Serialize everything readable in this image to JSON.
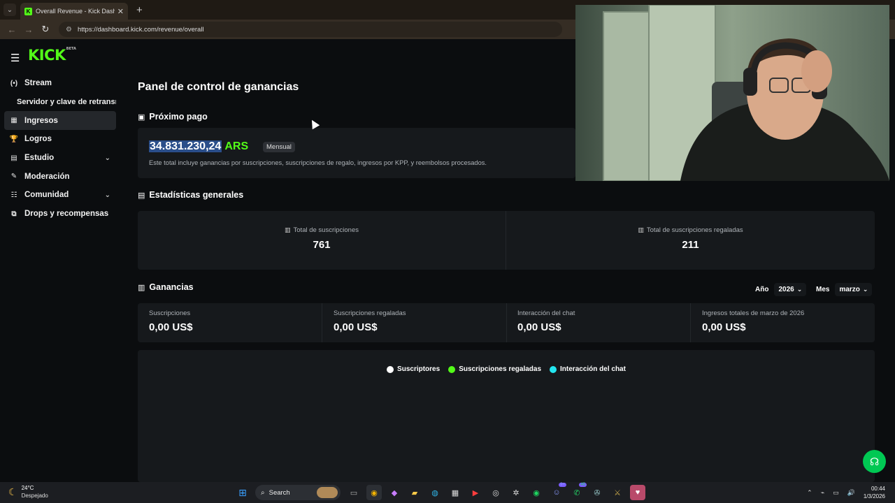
{
  "browser": {
    "tab_title": "Overall Revenue - Kick Dashbo...",
    "favicon": "K",
    "new_tab": "+",
    "url": "https://dashboard.kick.com/revenue/overall"
  },
  "brand": {
    "logo": "KICK",
    "logo_tag": "BETA",
    "accent": "#53fc18"
  },
  "sidebar": {
    "items": [
      {
        "label": "Stream",
        "icon": "broadcast-icon",
        "glyph": "(•)"
      },
      {
        "label": "Servidor y clave de retransmisión",
        "icon": "",
        "glyph": ""
      },
      {
        "label": "Ingresos",
        "icon": "revenue-icon",
        "glyph": "▦"
      },
      {
        "label": "Logros",
        "icon": "trophy-icon",
        "glyph": "🏆"
      },
      {
        "label": "Estudio",
        "icon": "studio-icon",
        "glyph": "▤"
      },
      {
        "label": "Moderación",
        "icon": "wrench-icon",
        "glyph": "✎"
      },
      {
        "label": "Comunidad",
        "icon": "community-icon",
        "glyph": "☷"
      },
      {
        "label": "Drops y recompensas",
        "icon": "drops-icon",
        "glyph": "⧉"
      }
    ]
  },
  "main": {
    "title": "Panel de control de ganancias",
    "next_payment": {
      "heading": "Próximo pago",
      "amount": "34.831.230,24",
      "currency": "ARS",
      "badge": "Mensual",
      "description": "Este total incluye ganancias por suscripciones, suscripciones de regalo, ingresos por KPP, y reembolsos procesados."
    },
    "general_stats": {
      "heading": "Estadísticas generales",
      "total_subs_label": "Total de suscripciones",
      "total_subs_value": "761",
      "total_gifted_label": "Total de suscripciones regaladas",
      "total_gifted_value": "211"
    },
    "earnings": {
      "heading": "Ganancias",
      "year_label": "Año",
      "year_value": "2026",
      "month_label": "Mes",
      "month_value": "marzo",
      "cards": [
        {
          "label": "Suscripciones",
          "value": "0,00 US$"
        },
        {
          "label": "Suscripciones regaladas",
          "value": "0,00 US$"
        },
        {
          "label": "Interacción del chat",
          "value": "0,00 US$"
        },
        {
          "label": "Ingresos totales de marzo de 2026",
          "value": "0,00 US$"
        }
      ]
    },
    "legend": [
      {
        "label": "Suscriptores",
        "color": "#ffffff"
      },
      {
        "label": "Suscripciones regaladas",
        "color": "#53fc18"
      },
      {
        "label": "Interacción del chat",
        "color": "#23e6f0"
      }
    ]
  },
  "taskbar": {
    "weather_temp": "24°C",
    "weather_desc": "Despejado",
    "search_placeholder": "Search",
    "badge_discord": "9+",
    "badge_whatsapp": "45",
    "time": "00:44",
    "date": "1/3/2026"
  }
}
